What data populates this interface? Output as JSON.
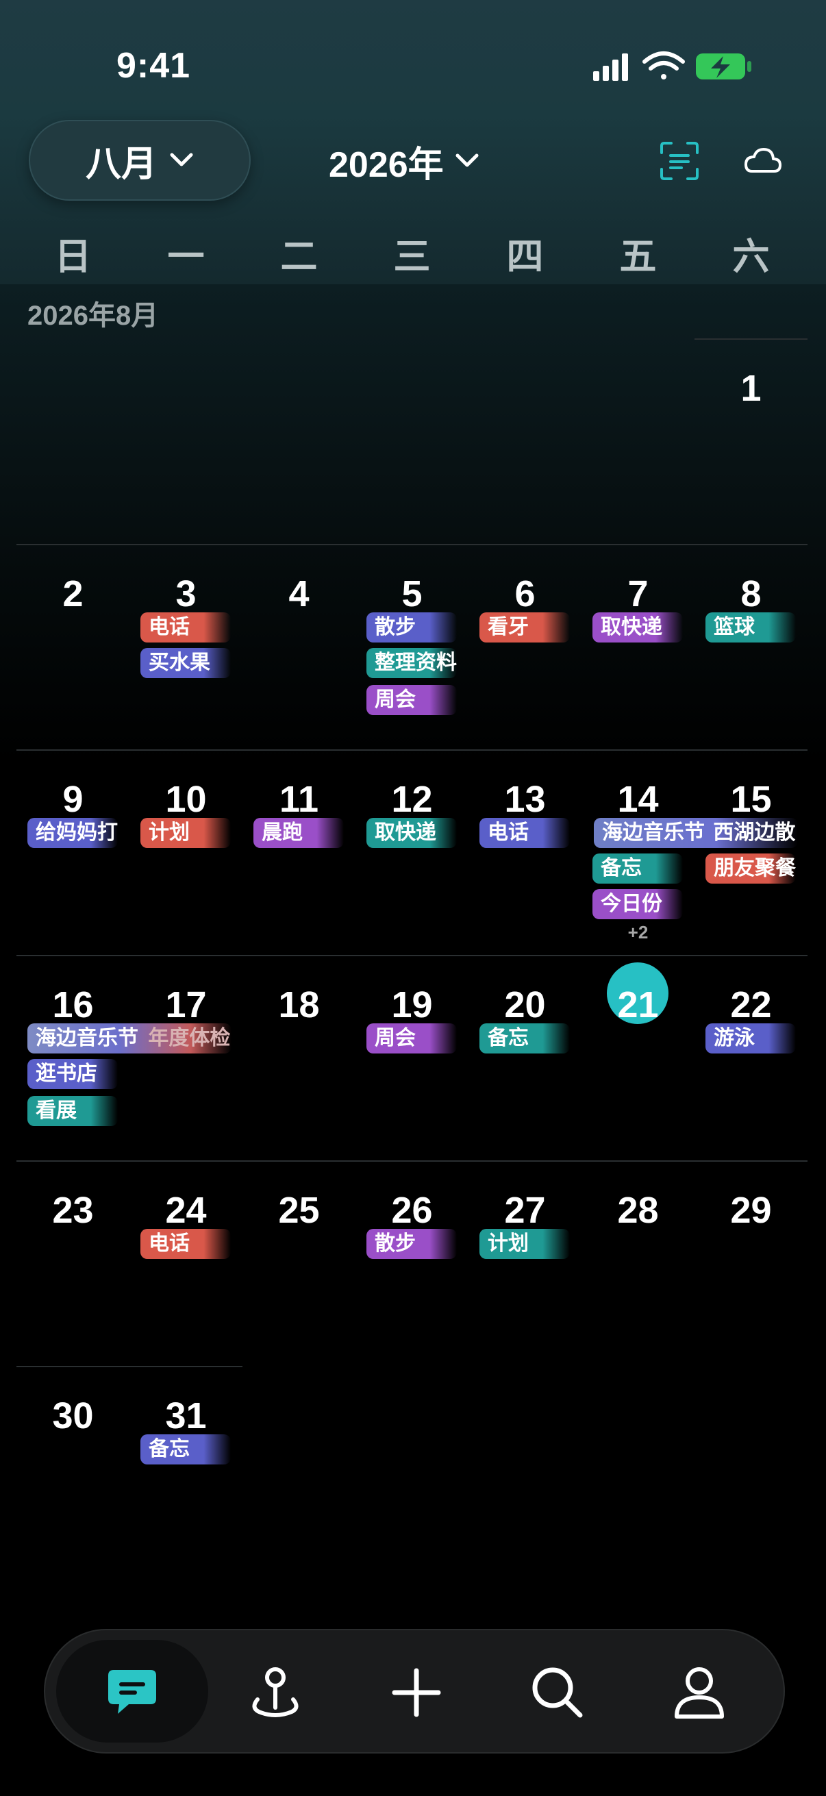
{
  "status": {
    "time": "9:41"
  },
  "header": {
    "month_label": "八月",
    "year_label": "2026年"
  },
  "colors": {
    "accent": "#27c0c4",
    "red": "#d9584a",
    "blue": "#5a5fc9",
    "purple": "#9a4fc8",
    "teal": "#1f9a94"
  },
  "weekdays": [
    "日",
    "一",
    "二",
    "三",
    "四",
    "五",
    "六"
  ],
  "month_caption": "2026年8月",
  "calendar": {
    "today": "21",
    "days": {
      "d1": "1",
      "d2": "2",
      "d3": "3",
      "d4": "4",
      "d5": "5",
      "d6": "6",
      "d7": "7",
      "d8": "8",
      "d9": "9",
      "d10": "10",
      "d11": "11",
      "d12": "12",
      "d13": "13",
      "d14": "14",
      "d15": "15",
      "d16": "16",
      "d17": "17",
      "d18": "18",
      "d19": "19",
      "d20": "20",
      "d21": "21",
      "d22": "22",
      "d23": "23",
      "d24": "24",
      "d25": "25",
      "d26": "26",
      "d27": "27",
      "d28": "28",
      "d29": "29",
      "d30": "30",
      "d31": "31"
    },
    "events": {
      "e3a": "电话",
      "e3b": "买水果",
      "e5a": "散步",
      "e5b": "整理资料",
      "e5c": "周会",
      "e6a": "看牙",
      "e7a": "取快递",
      "e8a": "篮球",
      "e9a": "给妈妈打",
      "e10a": "计划",
      "e11a": "晨跑",
      "e12a": "取快递",
      "e13a": "电话",
      "e14span": "海边音乐节",
      "e15span": "西湖边散",
      "e14b": "备忘",
      "e14c": "今日份",
      "e15b": "朋友聚餐",
      "e16span": "海边音乐节",
      "e17span": "年度体检",
      "e16b": "逛书店",
      "e16c": "看展",
      "e19a": "周会",
      "e20a": "备忘",
      "e22a": "游泳",
      "e24a": "电话",
      "e26a": "散步",
      "e27a": "计划",
      "e31a": "备忘"
    },
    "more_14": "+2"
  },
  "tabbar": {
    "items": [
      "chat-icon",
      "location-pin-icon",
      "plus-icon",
      "search-icon",
      "profile-icon"
    ]
  }
}
